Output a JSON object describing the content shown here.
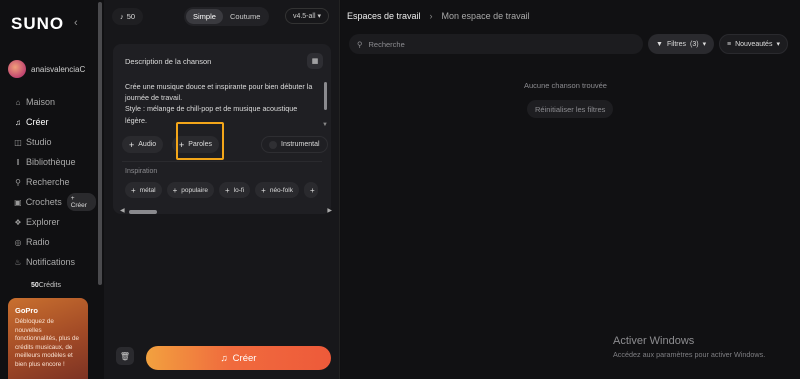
{
  "sidebar": {
    "logo": "SUNO",
    "username": "anaisvalenciaC",
    "nav": [
      {
        "label": "Maison",
        "icon": "home-icon",
        "active": false
      },
      {
        "label": "Créer",
        "icon": "create-icon",
        "active": true
      },
      {
        "label": "Studio",
        "icon": "studio-icon",
        "active": false
      },
      {
        "label": "Bibliothèque",
        "icon": "library-icon",
        "active": false
      },
      {
        "label": "Recherche",
        "icon": "search-icon",
        "active": false
      },
      {
        "label": "Crochets",
        "icon": "hooks-icon",
        "active": false,
        "badge": "+ Créer"
      },
      {
        "label": "Explorer",
        "icon": "explore-icon",
        "active": false
      },
      {
        "label": "Radio",
        "icon": "radio-icon",
        "active": false
      },
      {
        "label": "Notifications",
        "icon": "bell-icon",
        "active": false
      }
    ],
    "credits_value": "50",
    "credits_label": "Crédits",
    "promo": {
      "title": "GoPro",
      "text": "Débloquez de nouvelles fonctionnalités, plus de crédits musicaux, de meilleurs modèles et bien plus encore !"
    }
  },
  "create": {
    "credit_count": "50",
    "mode_simple": "Simple",
    "mode_custom": "Coutume",
    "version": "v4.5-all",
    "card_header": "Description de la chanson",
    "description": "Crée une musique douce et inspirante pour bien débuter la journée de travail.\nStyle : mélange de chill-pop et de musique acoustique légère.",
    "audio_label": "Audio",
    "lyrics_label": "Paroles",
    "instrumental_label": "Instrumental",
    "inspiration_label": "Inspiration",
    "tags": [
      "métal",
      "populaire",
      "lo-fi",
      "néo-folk",
      "r"
    ],
    "create_button": "Créer"
  },
  "workspace": {
    "crumb_root": "Espaces de travail",
    "crumb_current": "Mon espace de travail",
    "search_placeholder": "Recherche",
    "filter_label": "Filtres",
    "filter_count": "(3)",
    "sort_label": "Nouveautés",
    "empty_text": "Aucune chanson trouvée",
    "reset_label": "Réinitialiser les filtres"
  },
  "os_watermark": {
    "title": "Activer Windows",
    "subtitle": "Accédez aux paramètres pour activer Windows."
  },
  "colors": {
    "accent_orange": "#f06b3d",
    "highlight_box": "#f3a61a",
    "background": "#101012"
  }
}
